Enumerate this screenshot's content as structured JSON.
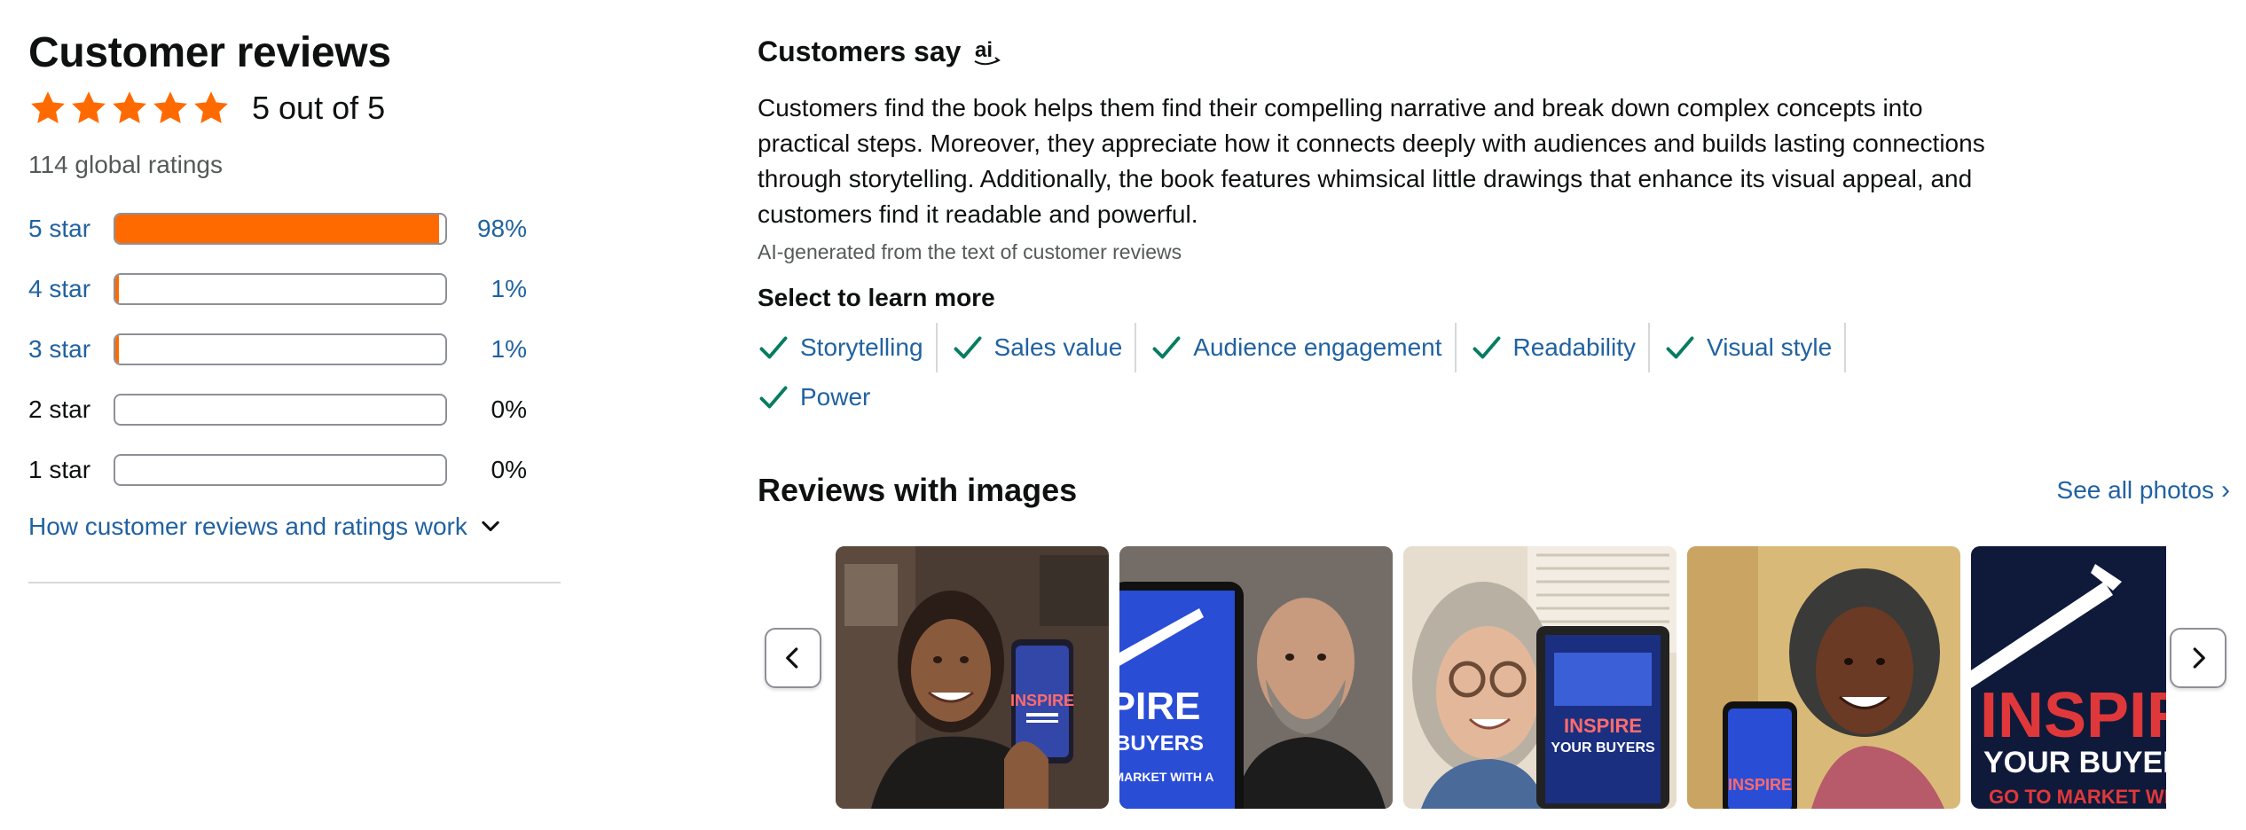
{
  "reviews": {
    "title": "Customer reviews",
    "rating_text": "5 out of 5",
    "rating_value": 5,
    "global_ratings": "114 global ratings",
    "histogram": [
      {
        "label": "5 star",
        "percent_text": "98%",
        "fraction": 0.98,
        "link": true
      },
      {
        "label": "4 star",
        "percent_text": "1%",
        "fraction": 0.01,
        "link": true
      },
      {
        "label": "3 star",
        "percent_text": "1%",
        "fraction": 0.01,
        "link": true
      },
      {
        "label": "2 star",
        "percent_text": "0%",
        "fraction": 0.0,
        "link": false
      },
      {
        "label": "1 star",
        "percent_text": "0%",
        "fraction": 0.0,
        "link": false
      }
    ],
    "how_link": "How customer reviews and ratings work"
  },
  "customers_say": {
    "title": "Customers say",
    "ai_icon": "ai-badge-icon",
    "summary": "Customers find the book helps them find their compelling narrative and break down complex concepts into practical steps. Moreover, they appreciate how it connects deeply with audiences and builds lasting connections through storytelling. Additionally, the book features whimsical little drawings that enhance its visual appeal, and customers find it readable and powerful.",
    "ai_note": "AI-generated from the text of customer reviews",
    "select_label": "Select to learn more",
    "aspects": [
      "Storytelling",
      "Sales value",
      "Audience engagement",
      "Readability",
      "Visual style",
      "Power"
    ]
  },
  "images_section": {
    "title": "Reviews with images",
    "see_all": "See all photos",
    "prev_icon": "chevron-left-icon",
    "next_icon": "chevron-right-icon"
  },
  "colors": {
    "star": "#ff6a00",
    "bar_fill": "#ff6a00",
    "link": "#2162a1",
    "check": "#067d62"
  }
}
